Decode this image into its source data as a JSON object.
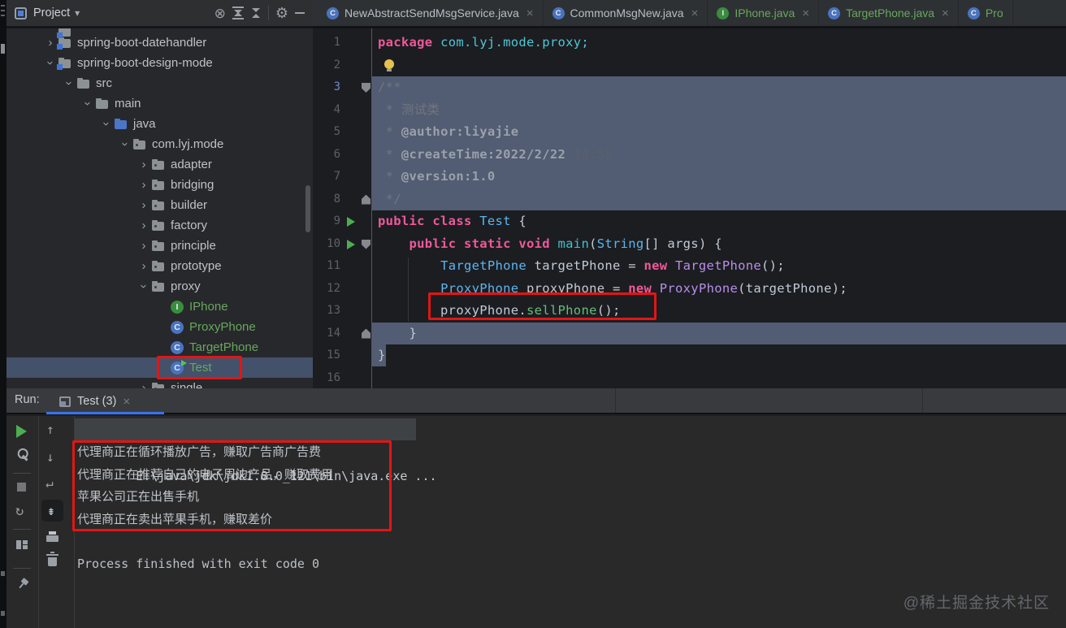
{
  "glyphs": {
    "caret": "▾",
    "locate": "⊗",
    "gear": "⚙",
    "close": "×",
    "up": "↑",
    "down": "↓",
    "wrap": "↵",
    "scroll_end": "⇟",
    "refresh": "↻",
    "chevron": "›"
  },
  "colors": {
    "accent_blue": "#3673f0",
    "annotation_red": "#e31515",
    "keyword_pink": "#f0589a",
    "type_blue": "#5cb5ee",
    "constructor_purple": "#b98ee9",
    "method_green": "#68bd79",
    "vcs_green": "#68a75e",
    "selection": "#525c72"
  },
  "project_panel": {
    "toolbar": {
      "title": "Project"
    },
    "tree": [
      {
        "label": "",
        "level": 1,
        "icon": "module",
        "chevron": null,
        "partial": true
      },
      {
        "label": "spring-boot-datehandler",
        "level": 1,
        "icon": "module",
        "chevron": "collapsed"
      },
      {
        "label": "spring-boot-design-mode",
        "level": 1,
        "icon": "module",
        "chevron": "expanded"
      },
      {
        "label": "src",
        "level": 2,
        "icon": "folder",
        "chevron": "expanded"
      },
      {
        "label": "main",
        "level": 3,
        "icon": "folder",
        "chevron": "expanded"
      },
      {
        "label": "java",
        "level": 4,
        "icon": "folder-src",
        "chevron": "expanded"
      },
      {
        "label": "com.lyj.mode",
        "level": 5,
        "icon": "package",
        "chevron": "expanded"
      },
      {
        "label": "adapter",
        "level": 6,
        "icon": "package",
        "chevron": "collapsed"
      },
      {
        "label": "bridging",
        "level": 6,
        "icon": "package",
        "chevron": "collapsed"
      },
      {
        "label": "builder",
        "level": 6,
        "icon": "package",
        "chevron": "collapsed"
      },
      {
        "label": "factory",
        "level": 6,
        "icon": "package",
        "chevron": "collapsed"
      },
      {
        "label": "principle",
        "level": 6,
        "icon": "package",
        "chevron": "collapsed"
      },
      {
        "label": "prototype",
        "level": 6,
        "icon": "package",
        "chevron": "collapsed"
      },
      {
        "label": "proxy",
        "level": 6,
        "icon": "package",
        "chevron": "expanded"
      },
      {
        "label": "IPhone",
        "level": 7,
        "icon": "interface",
        "green": true
      },
      {
        "label": "ProxyPhone",
        "level": 7,
        "icon": "class",
        "green": true
      },
      {
        "label": "TargetPhone",
        "level": 7,
        "icon": "class",
        "green": true
      },
      {
        "label": "Test",
        "level": 7,
        "icon": "class-run",
        "green": true,
        "selected": true
      },
      {
        "label": "single",
        "level": 6,
        "icon": "package",
        "chevron": "collapsed"
      }
    ]
  },
  "editor_tabs": [
    {
      "label": "NewAbstractSendMsgService.java",
      "icon": "class",
      "close": true
    },
    {
      "label": "CommonMsgNew.java",
      "icon": "class",
      "close": true
    },
    {
      "label": "IPhone.java",
      "icon": "interface",
      "green": true,
      "close": true
    },
    {
      "label": "TargetPhone.java",
      "icon": "class",
      "green": true,
      "close": true
    },
    {
      "label": "Pro",
      "icon": "class",
      "green": true,
      "close": false,
      "clipped": true
    }
  ],
  "editor": {
    "lines": [
      {
        "num": "1",
        "tokens": [
          [
            "package ",
            "kw"
          ],
          [
            "com.lyj.mode.proxy;",
            "pkg"
          ]
        ]
      },
      {
        "num": "2",
        "bulb": true,
        "tokens": []
      },
      {
        "num": "3",
        "numActive": true,
        "fold": "down",
        "sel": true,
        "tokens": [
          [
            "/**",
            "cmt"
          ]
        ]
      },
      {
        "num": "4",
        "sel": true,
        "tokens": [
          [
            " * 测试类",
            "cmt"
          ]
        ]
      },
      {
        "num": "5",
        "sel": true,
        "tokens": [
          [
            " * ",
            "cmt"
          ],
          [
            "@author:liyajie",
            "cmtb"
          ]
        ]
      },
      {
        "num": "6",
        "sel": true,
        "tokens": [
          [
            " * ",
            "cmt"
          ],
          [
            "@createTime:2022/2/22",
            "cmtb"
          ],
          [
            " 14:55",
            "cmtd"
          ]
        ]
      },
      {
        "num": "7",
        "sel": true,
        "tokens": [
          [
            " * ",
            "cmt"
          ],
          [
            "@version:1.0",
            "cmtb"
          ]
        ]
      },
      {
        "num": "8",
        "fold": "up",
        "sel": true,
        "tokens": [
          [
            " */",
            "cmt"
          ]
        ]
      },
      {
        "num": "9",
        "run": true,
        "tokens": [
          [
            "public class ",
            "kw"
          ],
          [
            "Test",
            "cls"
          ],
          [
            " {",
            "pln"
          ]
        ]
      },
      {
        "num": "10",
        "run": true,
        "fold": "down",
        "tokens": [
          [
            "    ",
            "pln"
          ],
          [
            "public static void ",
            "kw"
          ],
          [
            "main",
            "mthd"
          ],
          [
            "(",
            "pln"
          ],
          [
            "String",
            "cls"
          ],
          [
            "[] args) {",
            "pln"
          ]
        ]
      },
      {
        "num": "11",
        "tokens": [
          [
            "        ",
            "pln"
          ],
          [
            "TargetPhone",
            "cls"
          ],
          [
            " targetPhone = ",
            "pln"
          ],
          [
            "new ",
            "kw"
          ],
          [
            "TargetPhone",
            "ctor"
          ],
          [
            "();",
            "pln"
          ]
        ]
      },
      {
        "num": "12",
        "tokens": [
          [
            "        ",
            "pln"
          ],
          [
            "ProxyPhone",
            "cls"
          ],
          [
            " proxyPhone = ",
            "pln"
          ],
          [
            "new ",
            "kw"
          ],
          [
            "ProxyPhone",
            "ctor"
          ],
          [
            "(targetPhone);",
            "pln"
          ]
        ]
      },
      {
        "num": "13",
        "boxed": true,
        "tokens": [
          [
            "        proxyPhone.",
            "pln"
          ],
          [
            "sellPhone",
            "mth"
          ],
          [
            "();",
            "pln"
          ]
        ]
      },
      {
        "num": "14",
        "fold": "up",
        "sel": true,
        "tokens": [
          [
            "    }",
            "pln"
          ]
        ]
      },
      {
        "num": "15",
        "selBrace": true,
        "tokens": [
          [
            "}",
            "pln"
          ]
        ]
      },
      {
        "num": "16",
        "tokens": []
      }
    ]
  },
  "run_panel": {
    "label": "Run:",
    "tab": {
      "label": "Test (3)"
    },
    "console": {
      "cmd": "E:\\java\\jdk\\jdk1.8.0_121\\bin\\java.exe ...",
      "output": [
        "代理商正在循环播放广告，赚取广告商广告费",
        "代理商正在推荐自己的电子周边产品，赚取费用",
        "苹果公司正在出售手机",
        "代理商正在卖出苹果手机，赚取差价"
      ],
      "process": "Process finished with exit code 0"
    }
  },
  "watermark": "@稀土掘金技术社区"
}
